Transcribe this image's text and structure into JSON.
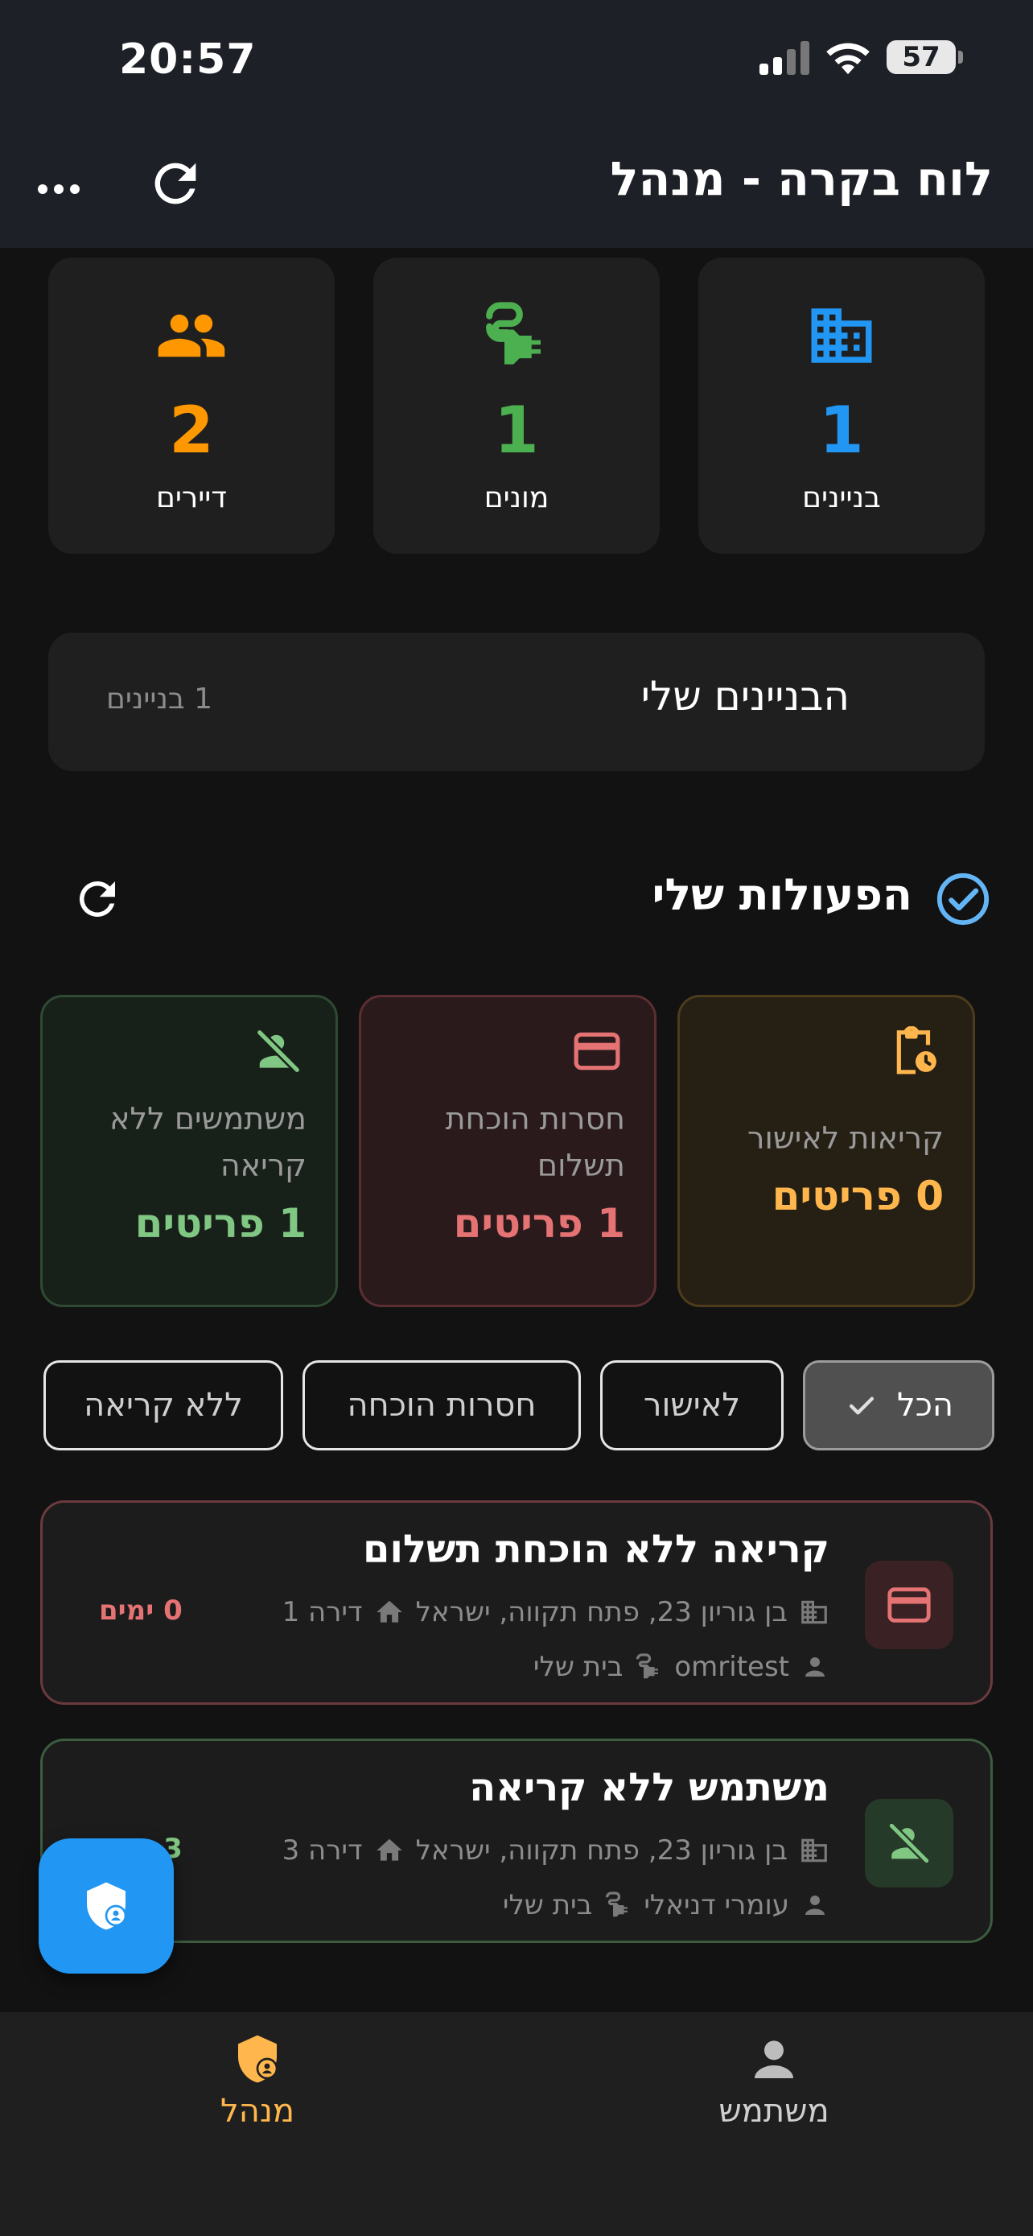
{
  "status_bar": {
    "time": "20:57",
    "battery": "57"
  },
  "app_bar": {
    "title": "לוח בקרה - מנהל"
  },
  "stats": [
    {
      "value": "1",
      "label": "בניינים",
      "color": "#2196f3",
      "icon": "building-icon"
    },
    {
      "value": "1",
      "label": "מונים",
      "color": "#4caf50",
      "icon": "ev-plug-icon"
    },
    {
      "value": "2",
      "label": "דיירים",
      "color": "#ff9800",
      "icon": "people-icon"
    }
  ],
  "buildings": {
    "title": "הבניינים שלי",
    "count": "1 בניינים"
  },
  "actions": {
    "title": "הפעולות שלי",
    "categories": [
      {
        "label": "קריאות לאישור",
        "count": "0 פריטים",
        "color": "#ffb74d",
        "icon": "clipboard-clock-icon"
      },
      {
        "label": "חסרות הוכחת תשלום",
        "count": "1 פריטים",
        "color": "#e57373",
        "icon": "credit-card-icon"
      },
      {
        "label": "משתמשים ללא קריאה",
        "count": "1 פריטים",
        "color": "#81c784",
        "icon": "person-off-icon"
      }
    ],
    "filters": [
      "הכל",
      "לאישור",
      "חסרות הוכחה",
      "ללא קריאה"
    ]
  },
  "items": [
    {
      "title": "קריאה ללא הוכחת תשלום",
      "address": "בן גוריון 23, פתח תקווה, ישראל",
      "apartment": "דירה 1",
      "user": "omritest",
      "meter": "בית שלי",
      "days": "0 ימים",
      "color": "#e57373"
    },
    {
      "title": "משתמש ללא קריאה",
      "address": "בן גוריון 23, פתח תקווה, ישראל",
      "apartment": "דירה 3",
      "user": "עומרי דניאלי",
      "meter": "בית שלי",
      "days": "3 ימים",
      "color": "#81c784"
    }
  ],
  "bottom_nav": {
    "admin": "מנהל",
    "user": "משתמש"
  }
}
